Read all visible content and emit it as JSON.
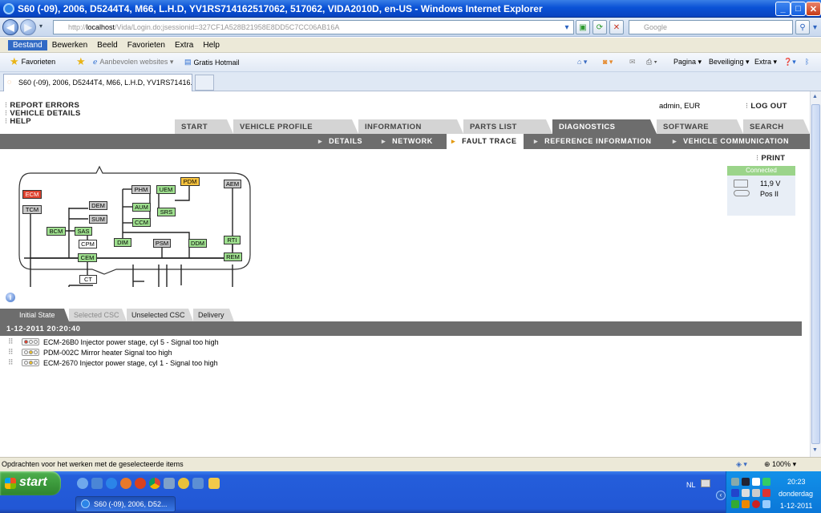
{
  "window": {
    "title": "S60 (-09), 2006, D5244T4, M66, L.H.D, YV1RS714162517062, 517062, VIDA2010D, en-US - Windows Internet Explorer",
    "min": "_",
    "max": "□",
    "close": "✕"
  },
  "addressbar": {
    "url_prefix": "http://",
    "url_host": "localhost",
    "url_path": "/Vida/Login.do;jsessionid=327CF1A528B21958E8DD5C7CC06AB16A",
    "search_placeholder": "Google"
  },
  "menubar": [
    "Bestand",
    "Bewerken",
    "Beeld",
    "Favorieten",
    "Extra",
    "Help"
  ],
  "favbar": {
    "favorites": "Favorieten",
    "suggested": "Aanbevolen websites ▾",
    "hotmail": "Gratis Hotmail",
    "pagina": "Pagina ▾",
    "beveiliging": "Beveiliging ▾",
    "extra": "Extra ▾"
  },
  "browser_tab": {
    "label": "S60 (-09), 2006, D5244T4, M66, L.H.D, YV1RS71416..."
  },
  "vida": {
    "top_links": [
      "REPORT ERRORS",
      "VEHICLE DETAILS",
      "HELP"
    ],
    "user": "admin, EUR",
    "logout": "LOG OUT",
    "main_tabs": [
      "START",
      "VEHICLE PROFILE",
      "INFORMATION",
      "PARTS LIST",
      "DIAGNOSTICS",
      "SOFTWARE",
      "SEARCH"
    ],
    "sub_nav": [
      "DETAILS",
      "NETWORK",
      "FAULT TRACE",
      "REFERENCE INFORMATION",
      "VEHICLE COMMUNICATION"
    ],
    "print": "PRINT",
    "status": {
      "header": "Connected",
      "voltage": "11,9 V",
      "key": "Pos II"
    },
    "ecu_nodes": [
      "ECM",
      "TCM",
      "DEM",
      "SUM",
      "BCM",
      "SAS",
      "CPM",
      "CEM",
      "CT",
      "PHM",
      "UEM",
      "PDM",
      "AUM",
      "SRS",
      "CCM",
      "DIM",
      "PSM",
      "DDM",
      "AEM",
      "RTI",
      "REM"
    ],
    "info_icon": "i",
    "sub_tabs": [
      "Initial State",
      "Selected CSC",
      "Unselected CSC",
      "Delivery"
    ],
    "date": "1-12-2011 20:20:40",
    "faults": [
      {
        "code": "ECM-26B0 Injector power stage, cyl 5 - Signal too high",
        "light": "red"
      },
      {
        "code": "PDM-002C Mirror heater Signal too high",
        "light": "yellow"
      },
      {
        "code": "ECM-2670 Injector power stage, cyl 1 - Signal too high",
        "light": "yellow"
      }
    ]
  },
  "ie_status": {
    "text": "Opdrachten voor het werken met de geselecteerde items",
    "zoom": "100%"
  },
  "taskbar": {
    "start": "start",
    "task": "S60 (-09), 2006, D52...",
    "lang": "NL",
    "time": "20:23",
    "day": "donderdag",
    "date": "1-12-2011"
  },
  "colors": {
    "connected": "#9bd48a",
    "tab_active": "#6d6d6d",
    "ecu_ok": "#9fe08f",
    "ecu_fault": "#e0432f",
    "ecu_warn": "#f6c23e"
  }
}
